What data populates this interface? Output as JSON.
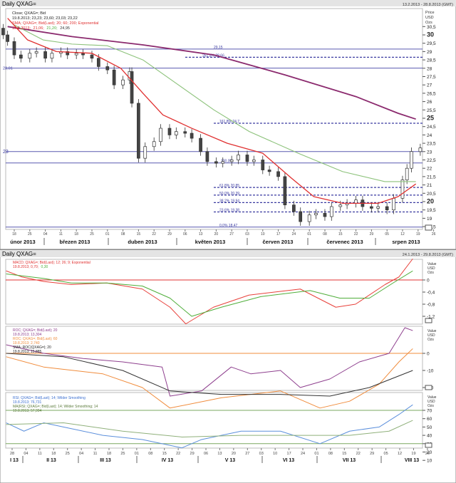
{
  "top_window": {
    "title": "Daily QXAG=",
    "range": "13.2.2013 - 28.8.2013 (GMT)",
    "axis_unit": [
      "Price",
      "USD",
      "Ozs"
    ],
    "legend": {
      "close_name": "Close; QXAG=; Bid",
      "close_values": "19.8.2013; 23,23; 23,60; 23,03; 23,22",
      "sma_name": "SMA; QXAG=; Bid(Last);  20; 60; 200; Exponential",
      "sma_date": "19.8.2013;",
      "sma_v20": "21,06;",
      "sma_v60": "21,20;",
      "sma_v200": "24,95"
    },
    "left_labels": {
      "l2801": "28,01",
      "l23": "23"
    },
    "fib_labels": {
      "f29": "29,15",
      "f261": "261,8% 28,66",
      "f161": "161,8% 24,7",
      "f100": "100,0%",
      "f618": "61,8%  20,85",
      "f50": "50,0%  20,39",
      "f382": "38,2%  19,94",
      "f236": "23,6%  19,38",
      "f0": "0,0%  18,47"
    },
    "date_ticks": [
      "18",
      "25",
      "04",
      "11",
      "18",
      "25",
      "01",
      "08",
      "15",
      "22",
      "29",
      "06",
      "13",
      "20",
      "27",
      "03",
      "10",
      "17",
      "24",
      "01",
      "08",
      "15",
      "22",
      "29",
      "05",
      "12",
      "19",
      "26"
    ],
    "months": [
      "únor 2013",
      "březen 2013",
      "duben 2013",
      "květen 2013",
      "červen 2013",
      "červenec 2013",
      "srpen 2013"
    ]
  },
  "bottom_window": {
    "title": "Daily QXAG=",
    "range": "24.1.2013 - 29.8.2013 (GMT)",
    "axis_unit": [
      "Value",
      "USD",
      "Ozs"
    ],
    "macd_legend": {
      "name": "MACD; QXAG=; Bid(Last);  12; 26; 9; Exponential",
      "date": "19.8.2013; 0,70;",
      "signal": "0,30"
    },
    "roc_legend": {
      "roc20_name": "ROC; QXAG=; Bid(Last);  20",
      "roc20_value": "19.8.2013; 13,304",
      "roc60_name": "ROC; QXAG=; Bid(Last);  60",
      "roc60_value": "19.8.2013; 2,740",
      "sma_name": "SMA; ROC(QXAG=);  20",
      "sma_value": "19.8.2013; 15,885"
    },
    "rsi_legend": {
      "rsi_name": "RSI; QXAG=; Bid(Last);  14; Wilder Smoothing",
      "rsi_value": "19.8.2013; 76,731",
      "ma_name": "MA(RSI; QXAG=; Bid(Last);  14; Wilder Smoothing; 14",
      "ma_value": "19.8.2013; 57,994"
    },
    "date_ticks": [
      "28",
      "04",
      "11",
      "18",
      "25",
      "04",
      "11",
      "18",
      "25",
      "01",
      "08",
      "15",
      "22",
      "29",
      "06",
      "13",
      "20",
      "27",
      "03",
      "10",
      "17",
      "24",
      "01",
      "08",
      "15",
      "22",
      "29",
      "05",
      "12",
      "19",
      "26"
    ],
    "months": [
      "I 13",
      "II 13",
      "III 13",
      "IV 13",
      "V 13",
      "VI 13",
      "VII 13",
      "VIII 13"
    ]
  },
  "chart_data": [
    {
      "type": "candlestick",
      "title": "Daily QXAG= Close; Bid",
      "x_unit": "days since 2013-01-24",
      "ylabel": "Price USD Ozs",
      "ylim": [
        18.3,
        31.0
      ],
      "yticks": [
        "30,5",
        "30",
        "29,5",
        "29",
        "28,5",
        "28",
        "27,5",
        "27",
        "26,5",
        "26",
        "25,5",
        "25",
        "24,5",
        "24",
        "23,5",
        "23",
        "22,5",
        "22",
        "21,5",
        "21",
        "20,5",
        "20",
        "19,5",
        "19",
        "18,5"
      ],
      "closes": [
        [
          20,
          30.0
        ],
        [
          22,
          29.6
        ],
        [
          25,
          28.8
        ],
        [
          28,
          28.6
        ],
        [
          32,
          28.9
        ],
        [
          35,
          29.0
        ],
        [
          39,
          28.6
        ],
        [
          42,
          28.9
        ],
        [
          46,
          29.0
        ],
        [
          49,
          28.8
        ],
        [
          53,
          28.9
        ],
        [
          56,
          28.8
        ],
        [
          60,
          28.6
        ],
        [
          63,
          28.1
        ],
        [
          67,
          27.9
        ],
        [
          70,
          27.0
        ],
        [
          74,
          27.3
        ],
        [
          77,
          27.8
        ],
        [
          78,
          25.9
        ],
        [
          81,
          22.6
        ],
        [
          84,
          23.3
        ],
        [
          88,
          23.6
        ],
        [
          91,
          24.4
        ],
        [
          95,
          24.0
        ],
        [
          98,
          24.2
        ],
        [
          102,
          24.1
        ],
        [
          105,
          23.8
        ],
        [
          109,
          23.0
        ],
        [
          112,
          22.4
        ],
        [
          116,
          22.3
        ],
        [
          119,
          22.4
        ],
        [
          123,
          22.5
        ],
        [
          126,
          22.8
        ],
        [
          130,
          22.4
        ],
        [
          133,
          22.5
        ],
        [
          137,
          21.9
        ],
        [
          140,
          21.8
        ],
        [
          144,
          21.5
        ],
        [
          147,
          19.8
        ],
        [
          151,
          19.4
        ],
        [
          154,
          18.8
        ],
        [
          158,
          19.2
        ],
        [
          161,
          19.3
        ],
        [
          165,
          19.1
        ],
        [
          168,
          19.7
        ],
        [
          172,
          19.8
        ],
        [
          175,
          19.9
        ],
        [
          179,
          20.1
        ],
        [
          182,
          19.7
        ],
        [
          186,
          19.6
        ],
        [
          189,
          19.7
        ],
        [
          193,
          19.5
        ],
        [
          196,
          20.2
        ],
        [
          200,
          21.3
        ],
        [
          202,
          22.0
        ],
        [
          204,
          23.0
        ],
        [
          208,
          23.22
        ]
      ],
      "ema20": [
        [
          22,
          31.0
        ],
        [
          31,
          29.7
        ],
        [
          44,
          29.0
        ],
        [
          60,
          28.9
        ],
        [
          73,
          28.0
        ],
        [
          83,
          26.5
        ],
        [
          92,
          25.2
        ],
        [
          105,
          24.4
        ],
        [
          121,
          23.5
        ],
        [
          137,
          22.9
        ],
        [
          150,
          21.4
        ],
        [
          160,
          20.3
        ],
        [
          173,
          19.9
        ],
        [
          189,
          19.9
        ],
        [
          198,
          20.3
        ],
        [
          206,
          21.06
        ]
      ],
      "ema60": [
        [
          25,
          30.6
        ],
        [
          38,
          29.7
        ],
        [
          51,
          29.45
        ],
        [
          67,
          29.35
        ],
        [
          83,
          28.5
        ],
        [
          99,
          27.0
        ],
        [
          115,
          25.5
        ],
        [
          131,
          24.2
        ],
        [
          153,
          22.9
        ],
        [
          173,
          21.8
        ],
        [
          192,
          21.2
        ],
        [
          206,
          21.2
        ]
      ],
      "ema200": [
        [
          22,
          30.5
        ],
        [
          51,
          29.9
        ],
        [
          83,
          29.4
        ],
        [
          115,
          28.8
        ],
        [
          147,
          27.6
        ],
        [
          179,
          26.3
        ],
        [
          198,
          25.3
        ],
        [
          206,
          24.95
        ]
      ],
      "hlines_solid": [
        29.15,
        28.01,
        23.0,
        22.32,
        18.47
      ],
      "hlines_dashed": [
        28.66,
        24.7,
        20.85,
        20.39,
        19.94,
        19.38
      ]
    },
    {
      "type": "line",
      "title": "MACD; QXAG=; Bid(Last); 12; 26; 9; Exponential",
      "x_unit": "days since 2013-01-24",
      "ylim": [
        -1.55,
        0.9
      ],
      "yticks": [
        "0",
        "-0,4",
        "-0,8",
        "-1,2"
      ],
      "series": [
        {
          "name": "MACD",
          "color": "#e8403a",
          "points": [
            [
              1,
              0.3
            ],
            [
              9,
              0.1
            ],
            [
              20,
              -0.05
            ],
            [
              34,
              -0.15
            ],
            [
              52,
              -0.1
            ],
            [
              70,
              -0.3
            ],
            [
              84,
              -0.9
            ],
            [
              92,
              -1.45
            ],
            [
              106,
              -0.9
            ],
            [
              124,
              -0.5
            ],
            [
              150,
              -0.3
            ],
            [
              168,
              -0.9
            ],
            [
              178,
              -0.8
            ],
            [
              193,
              -0.15
            ],
            [
              200,
              0.1
            ],
            [
              207,
              0.7
            ]
          ]
        },
        {
          "name": "Signal",
          "color": "#4fae3a",
          "points": [
            [
              1,
              0.2
            ],
            [
              20,
              0.05
            ],
            [
              34,
              -0.1
            ],
            [
              52,
              -0.1
            ],
            [
              70,
              -0.2
            ],
            [
              84,
              -0.6
            ],
            [
              95,
              -1.2
            ],
            [
              110,
              -0.9
            ],
            [
              130,
              -0.55
            ],
            [
              155,
              -0.35
            ],
            [
              170,
              -0.6
            ],
            [
              185,
              -0.6
            ],
            [
              197,
              -0.1
            ],
            [
              207,
              0.3
            ]
          ]
        }
      ],
      "hline": 0
    },
    {
      "type": "line",
      "title": "ROC",
      "x_unit": "days since 2013-01-24",
      "ylim": [
        -34,
        22
      ],
      "yticks": [
        "0",
        "-10",
        "-20"
      ],
      "series": [
        {
          "name": "ROC 20",
          "color": "#8e3f8e",
          "points": [
            [
              1,
              5
            ],
            [
              20,
              0
            ],
            [
              40,
              -3
            ],
            [
              60,
              -5
            ],
            [
              80,
              -8
            ],
            [
              84,
              -25
            ],
            [
              100,
              -22
            ],
            [
              115,
              -8
            ],
            [
              125,
              -12
            ],
            [
              140,
              -10
            ],
            [
              150,
              -20
            ],
            [
              165,
              -15
            ],
            [
              180,
              -5
            ],
            [
              195,
              0
            ],
            [
              203,
              15
            ],
            [
              207,
              13.3
            ]
          ]
        },
        {
          "name": "ROC 60",
          "color": "#f08c3c",
          "points": [
            [
              1,
              -2
            ],
            [
              20,
              -8
            ],
            [
              50,
              -12
            ],
            [
              70,
              -20
            ],
            [
              84,
              -32
            ],
            [
              110,
              -26
            ],
            [
              140,
              -22
            ],
            [
              160,
              -32
            ],
            [
              175,
              -28
            ],
            [
              190,
              -18
            ],
            [
              200,
              -5
            ],
            [
              207,
              2.74
            ]
          ]
        },
        {
          "name": "SMA ROC 20",
          "color": "#333333",
          "points": [
            [
              1,
              0
            ],
            [
              30,
              -2
            ],
            [
              60,
              -10
            ],
            [
              84,
              -22
            ],
            [
              110,
              -24
            ],
            [
              140,
              -24
            ],
            [
              165,
              -25
            ],
            [
              185,
              -20
            ],
            [
              207,
              -10
            ]
          ]
        }
      ],
      "hline": 0
    },
    {
      "type": "line",
      "title": "RSI",
      "x_unit": "days since 2013-01-24",
      "ylim": [
        5,
        85
      ],
      "yticks": [
        "70",
        "60",
        "50",
        "40",
        "30",
        "20",
        "10"
      ],
      "series": [
        {
          "name": "RSI 14",
          "color": "#5b8fdc",
          "points": [
            [
              1,
              55
            ],
            [
              10,
              45
            ],
            [
              20,
              55
            ],
            [
              30,
              50
            ],
            [
              50,
              40
            ],
            [
              70,
              35
            ],
            [
              90,
              25
            ],
            [
              100,
              35
            ],
            [
              120,
              45
            ],
            [
              140,
              45
            ],
            [
              160,
              30
            ],
            [
              175,
              45
            ],
            [
              190,
              50
            ],
            [
              200,
              65
            ],
            [
              207,
              76.7
            ]
          ]
        },
        {
          "name": "MA RSI 14",
          "color": "#8fb07a",
          "points": [
            [
              1,
              53
            ],
            [
              30,
              55
            ],
            [
              60,
              45
            ],
            [
              90,
              38
            ],
            [
              120,
              40
            ],
            [
              150,
              40
            ],
            [
              175,
              40
            ],
            [
              195,
              45
            ],
            [
              207,
              58
            ]
          ]
        }
      ],
      "hlines": [
        70,
        30
      ]
    }
  ]
}
